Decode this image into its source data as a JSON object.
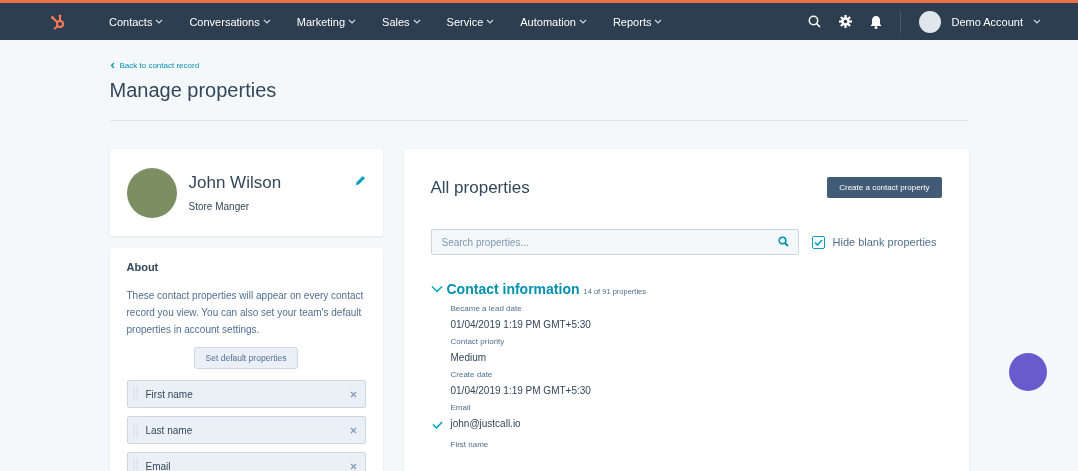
{
  "nav": {
    "menu": [
      {
        "label": "Contacts"
      },
      {
        "label": "Conversations"
      },
      {
        "label": "Marketing"
      },
      {
        "label": "Sales"
      },
      {
        "label": "Service"
      },
      {
        "label": "Automation"
      },
      {
        "label": "Reports"
      }
    ],
    "account": "Demo Account"
  },
  "back_link": "Back to contact record",
  "title": "Manage properties",
  "profile": {
    "name": "John Wilson",
    "job_title": "Store Manger"
  },
  "about": {
    "title": "About",
    "description": "These contact properties will appear on every contact record you view. You can also set your team's default properties in account settings.",
    "button": "Set default properties",
    "items": [
      {
        "label": "First name"
      },
      {
        "label": "Last name"
      },
      {
        "label": "Email"
      }
    ]
  },
  "properties_panel": {
    "title": "All properties",
    "create_button": "Create a contact property",
    "search": {
      "placeholder": "Search properties..."
    },
    "hide_blank": {
      "label": "Hide blank properties",
      "checked": true
    },
    "section": {
      "title": "Contact information",
      "count": "14 of 91 properties",
      "expanded": true,
      "properties": [
        {
          "label": "Became a lead date",
          "value": "01/04/2019 1:19 PM GMT+5:30",
          "checked": false
        },
        {
          "label": "Contact priority",
          "value": "Medium",
          "checked": false
        },
        {
          "label": "Create date",
          "value": "01/04/2019 1:19 PM GMT+5:30",
          "checked": false
        },
        {
          "label": "Email",
          "value": "john@justcall.io",
          "checked": true
        },
        {
          "label": "First name",
          "checked": false
        }
      ]
    }
  }
}
